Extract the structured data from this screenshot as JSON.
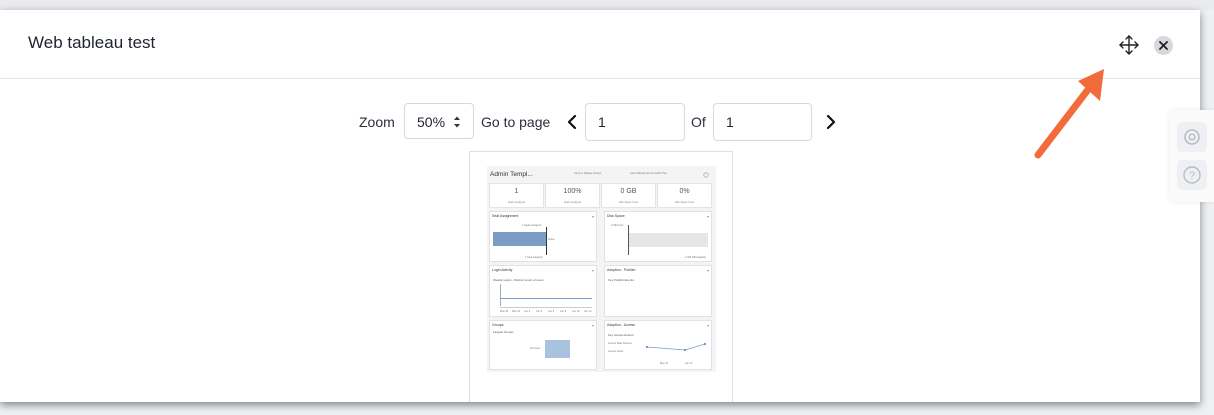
{
  "modal": {
    "title": "Web tableau test",
    "move_icon": "move-icon",
    "close_icon": "close-icon"
  },
  "toolbar": {
    "zoom_label": "Zoom",
    "zoom_value": "50%",
    "goto_label": "Go to page",
    "page_value": "1",
    "of_label": "Of",
    "total_pages": "1"
  },
  "dashboard": {
    "title": "Admin Templ...",
    "header_notes": [
      "Jump to Tableau Groups",
      "Learn Tableau Server Admin Tips"
    ],
    "kpis": [
      {
        "value": "1",
        "label": "Seats Assigned"
      },
      {
        "value": "100%",
        "label": "Seats Assigned"
      },
      {
        "value": "0 GB",
        "label": "Disk Space Used"
      },
      {
        "value": "0%",
        "label": "Disk Space Used"
      }
    ],
    "panels": [
      {
        "title": "Seat Assignment",
        "subtitle": "",
        "labels": [
          "1 Seats Assigned",
          "Active",
          "1 Seat Capacity"
        ]
      },
      {
        "title": "Disk Space",
        "subtitle": "",
        "labels": [
          "0 GB Used",
          "1,000 GB Capacity"
        ]
      },
      {
        "title": "Login Activity",
        "subtitle": "Weekly logins - Distinct count of users",
        "labels": [
          "May 29",
          "May 31",
          "Jun 2",
          "Jun 4",
          "Jun 6",
          "Jun 8",
          "Jun 10",
          "Jun 12"
        ]
      },
      {
        "title": "Adoption - Publish",
        "subtitle": "Key Publish Events",
        "labels": []
      },
      {
        "title": "Groups",
        "subtitle": "Largest Groups",
        "labels": [
          "All Users"
        ]
      },
      {
        "title": "Adoption - Access",
        "subtitle": "Key Access Events",
        "labels": [
          "Access Data Sources",
          "Access Views",
          "May 31",
          "Jun 12"
        ]
      }
    ]
  },
  "side_widget": {
    "icons": [
      "gear-icon",
      "help-icon"
    ]
  },
  "colors": {
    "accent_arrow": "#f26b3a",
    "bar_blue": "#7a9cc6"
  }
}
